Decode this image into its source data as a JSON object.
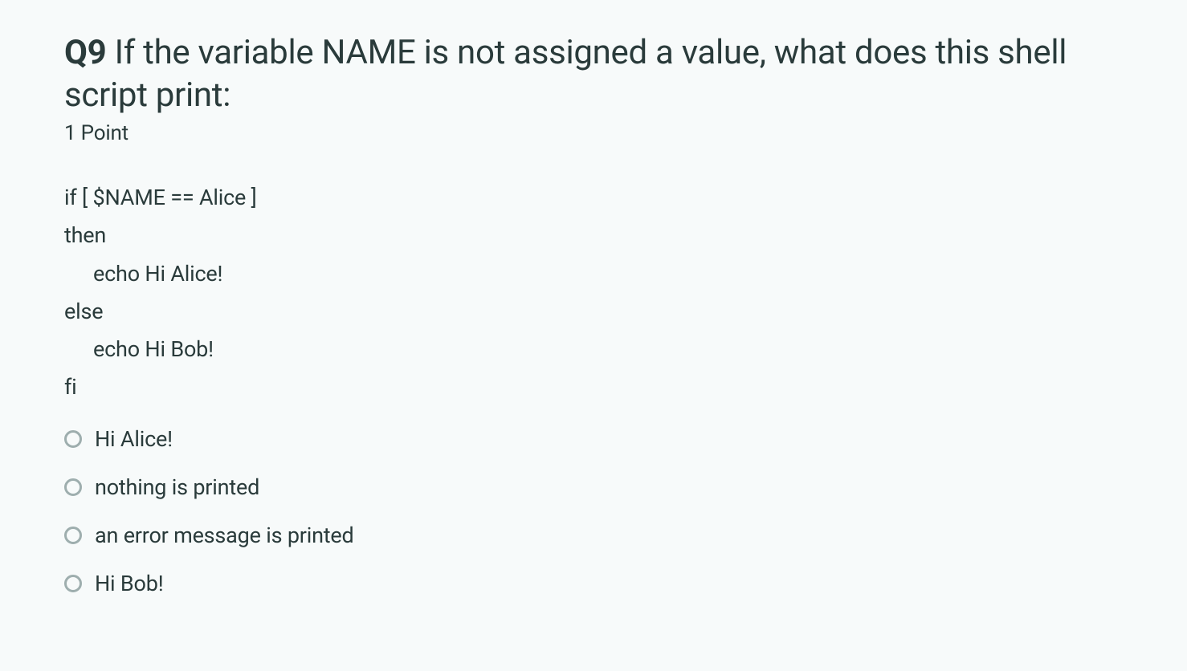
{
  "question": {
    "number": "Q9",
    "text": "If the variable NAME is not assigned a value, what does this shell script print:",
    "points": "1 Point"
  },
  "code": {
    "lines": [
      {
        "text": "if [ $NAME == Alice ]",
        "indent": false
      },
      {
        "text": "then",
        "indent": false
      },
      {
        "text": "echo Hi Alice!",
        "indent": true
      },
      {
        "text": "else",
        "indent": false
      },
      {
        "text": "echo Hi Bob!",
        "indent": true
      },
      {
        "text": "fi",
        "indent": false
      }
    ]
  },
  "options": [
    {
      "label": "Hi Alice!"
    },
    {
      "label": "nothing is printed"
    },
    {
      "label": "an error message is printed"
    },
    {
      "label": "Hi Bob!"
    }
  ]
}
